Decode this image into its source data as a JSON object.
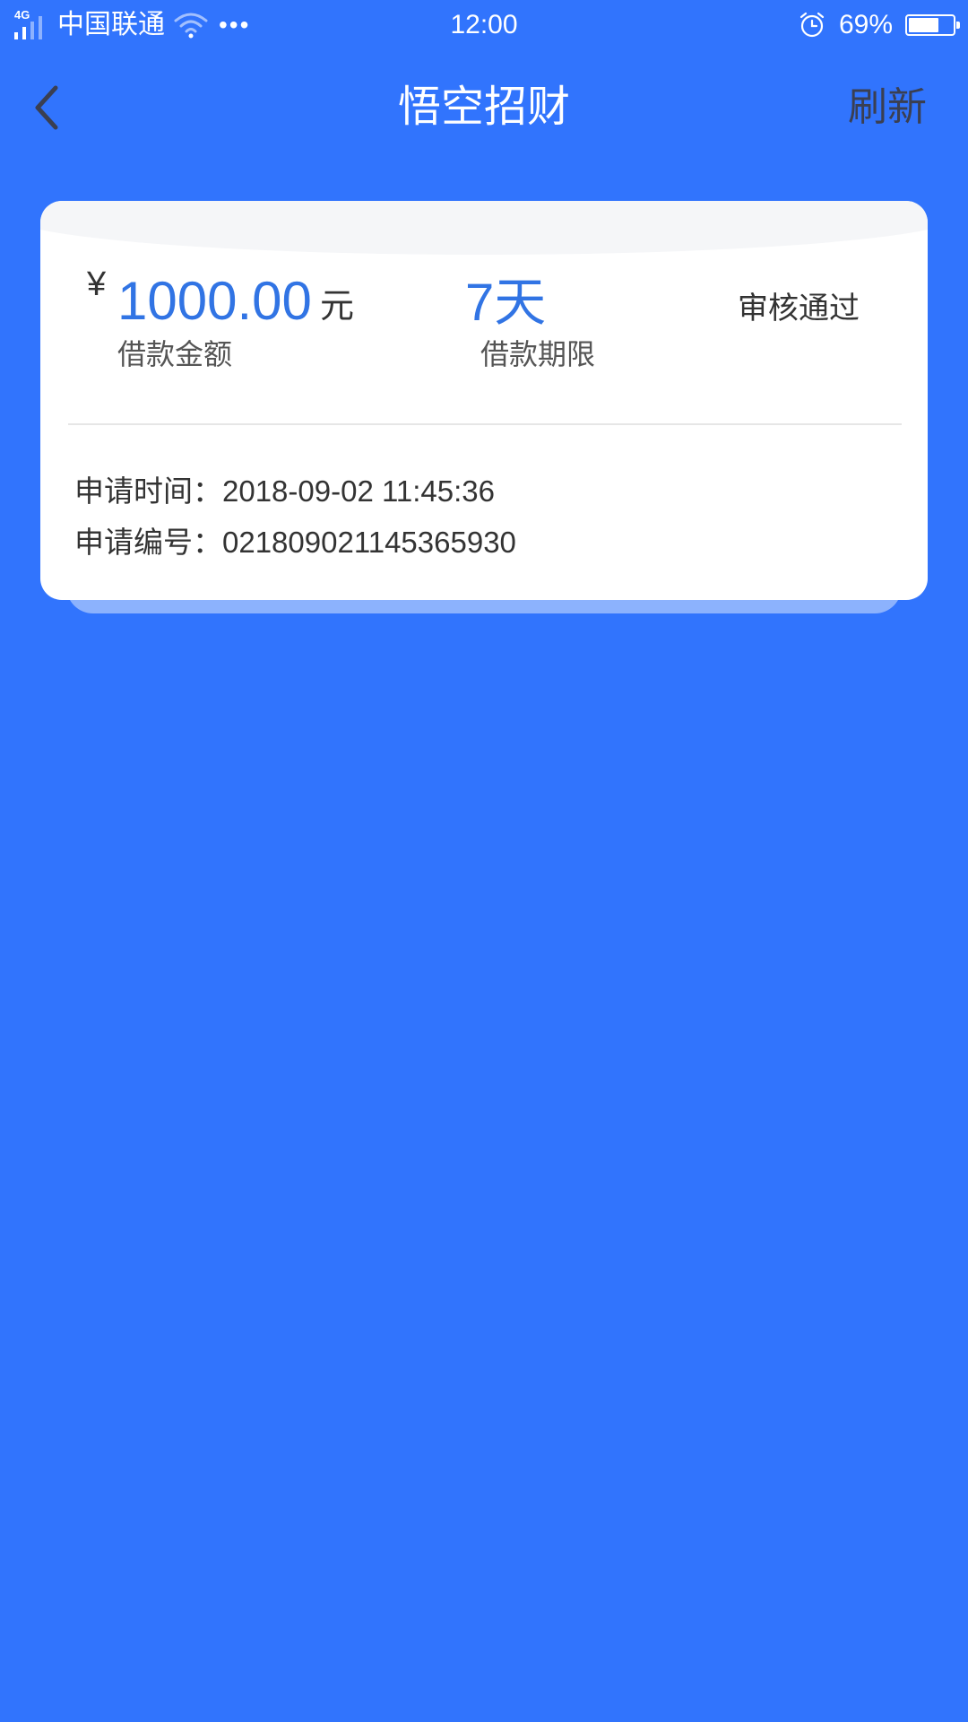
{
  "status_bar": {
    "network_type": "4G",
    "carrier": "中国联通",
    "time": "12:00",
    "battery_percent": "69%",
    "battery_level": 0.69
  },
  "nav": {
    "title": "悟空招财",
    "refresh_label": "刷新"
  },
  "loan": {
    "currency_symbol": "¥",
    "amount": "1000.00",
    "amount_unit": "元",
    "amount_label": "借款金额",
    "term": "7天",
    "term_label": "借款期限",
    "status": "审核通过",
    "apply_time_label": "申请时间：",
    "apply_time": "2018-09-02 11:45:36",
    "apply_number_label": "申请编号：",
    "apply_number": "0218090211453659​30"
  },
  "colors": {
    "background": "#3174fd",
    "accent": "#3174e4",
    "card": "#ffffff"
  },
  "icons": {
    "back": "chevron-left-icon",
    "wifi": "wifi-icon",
    "alarm": "alarm-clock-icon",
    "battery": "battery-icon",
    "signal": "signal-bars-icon",
    "more": "more-dots-icon"
  }
}
